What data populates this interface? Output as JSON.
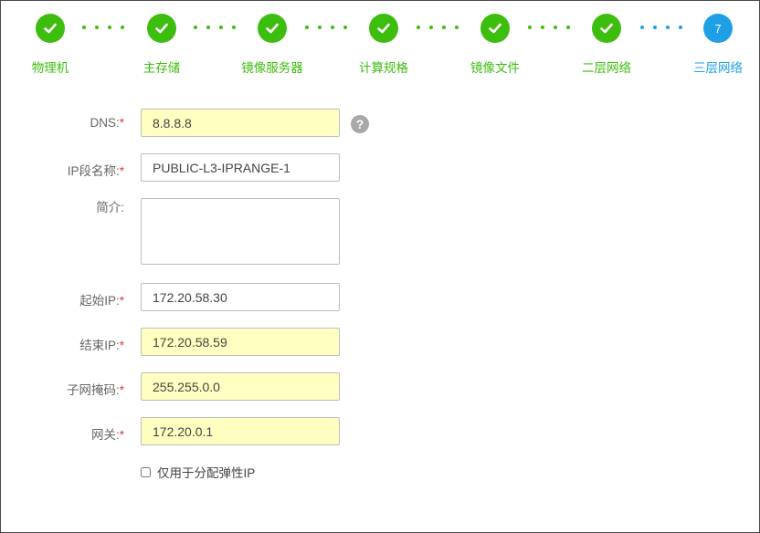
{
  "stepper": {
    "steps": [
      {
        "label": "物理机",
        "status": "done"
      },
      {
        "label": "主存储",
        "status": "done"
      },
      {
        "label": "镜像服务器",
        "status": "done"
      },
      {
        "label": "计算规格",
        "status": "done"
      },
      {
        "label": "镜像文件",
        "status": "done"
      },
      {
        "label": "二层网络",
        "status": "done"
      },
      {
        "label": "三层网络",
        "status": "current",
        "number": "7"
      }
    ],
    "colors": {
      "done": "#3dbd0d",
      "current": "#1e9fe6"
    },
    "icons": {
      "done": "check-icon"
    }
  },
  "form": {
    "required_mark": "*",
    "dns": {
      "label": "DNS:",
      "value": "8.8.8.8"
    },
    "help_icon": "?",
    "ip_range_name": {
      "label": "IP段名称:",
      "value": "PUBLIC-L3-IPRANGE-1"
    },
    "description": {
      "label": "简介:",
      "value": ""
    },
    "start_ip": {
      "label": "起始IP:",
      "value": "172.20.58.30"
    },
    "end_ip": {
      "label": "结束IP:",
      "value": "172.20.58.59"
    },
    "netmask": {
      "label": "子网掩码:",
      "value": "255.255.0.0"
    },
    "gateway": {
      "label": "网关:",
      "value": "172.20.0.1"
    },
    "elastic_ip_only": {
      "label": "仅用于分配弹性IP",
      "checked": false
    }
  }
}
